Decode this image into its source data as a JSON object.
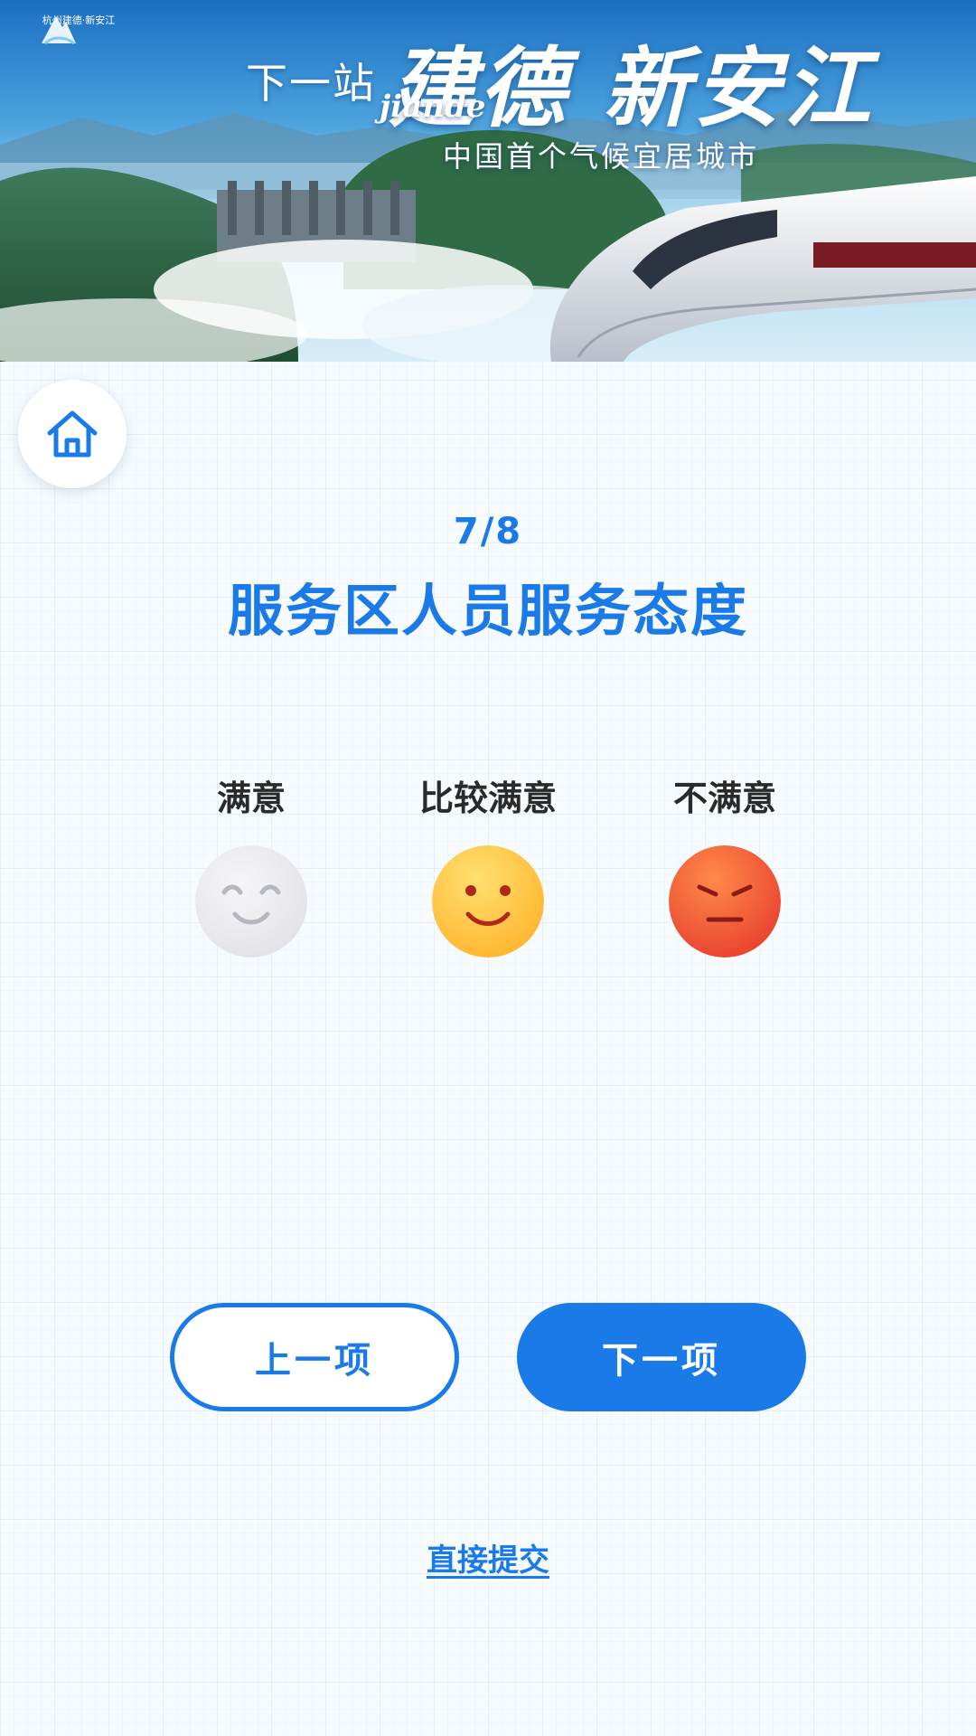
{
  "banner": {
    "brand_name": "杭州建德·新安江",
    "prefix": "下一站",
    "city": "建德",
    "latin": "jiande",
    "place": "新安江",
    "subtitle": "中国首个气候宜居城市"
  },
  "home": {
    "icon": "home-icon"
  },
  "question": {
    "progress": "7/8",
    "title": "服务区人员服务态度"
  },
  "options": [
    {
      "label": "满意",
      "icon": "smile-face-icon",
      "state": "unselected"
    },
    {
      "label": "比较满意",
      "icon": "happy-face-icon",
      "state": "normal"
    },
    {
      "label": "不满意",
      "icon": "angry-face-icon",
      "state": "normal"
    }
  ],
  "navigation": {
    "prev_label": "上一项",
    "next_label": "下一项",
    "submit_label": "直接提交"
  },
  "colors": {
    "accent": "#1a7ae8",
    "happy_face": "#ffc93c",
    "angry_face": "#f0563a",
    "neutral_face": "#ececef"
  }
}
